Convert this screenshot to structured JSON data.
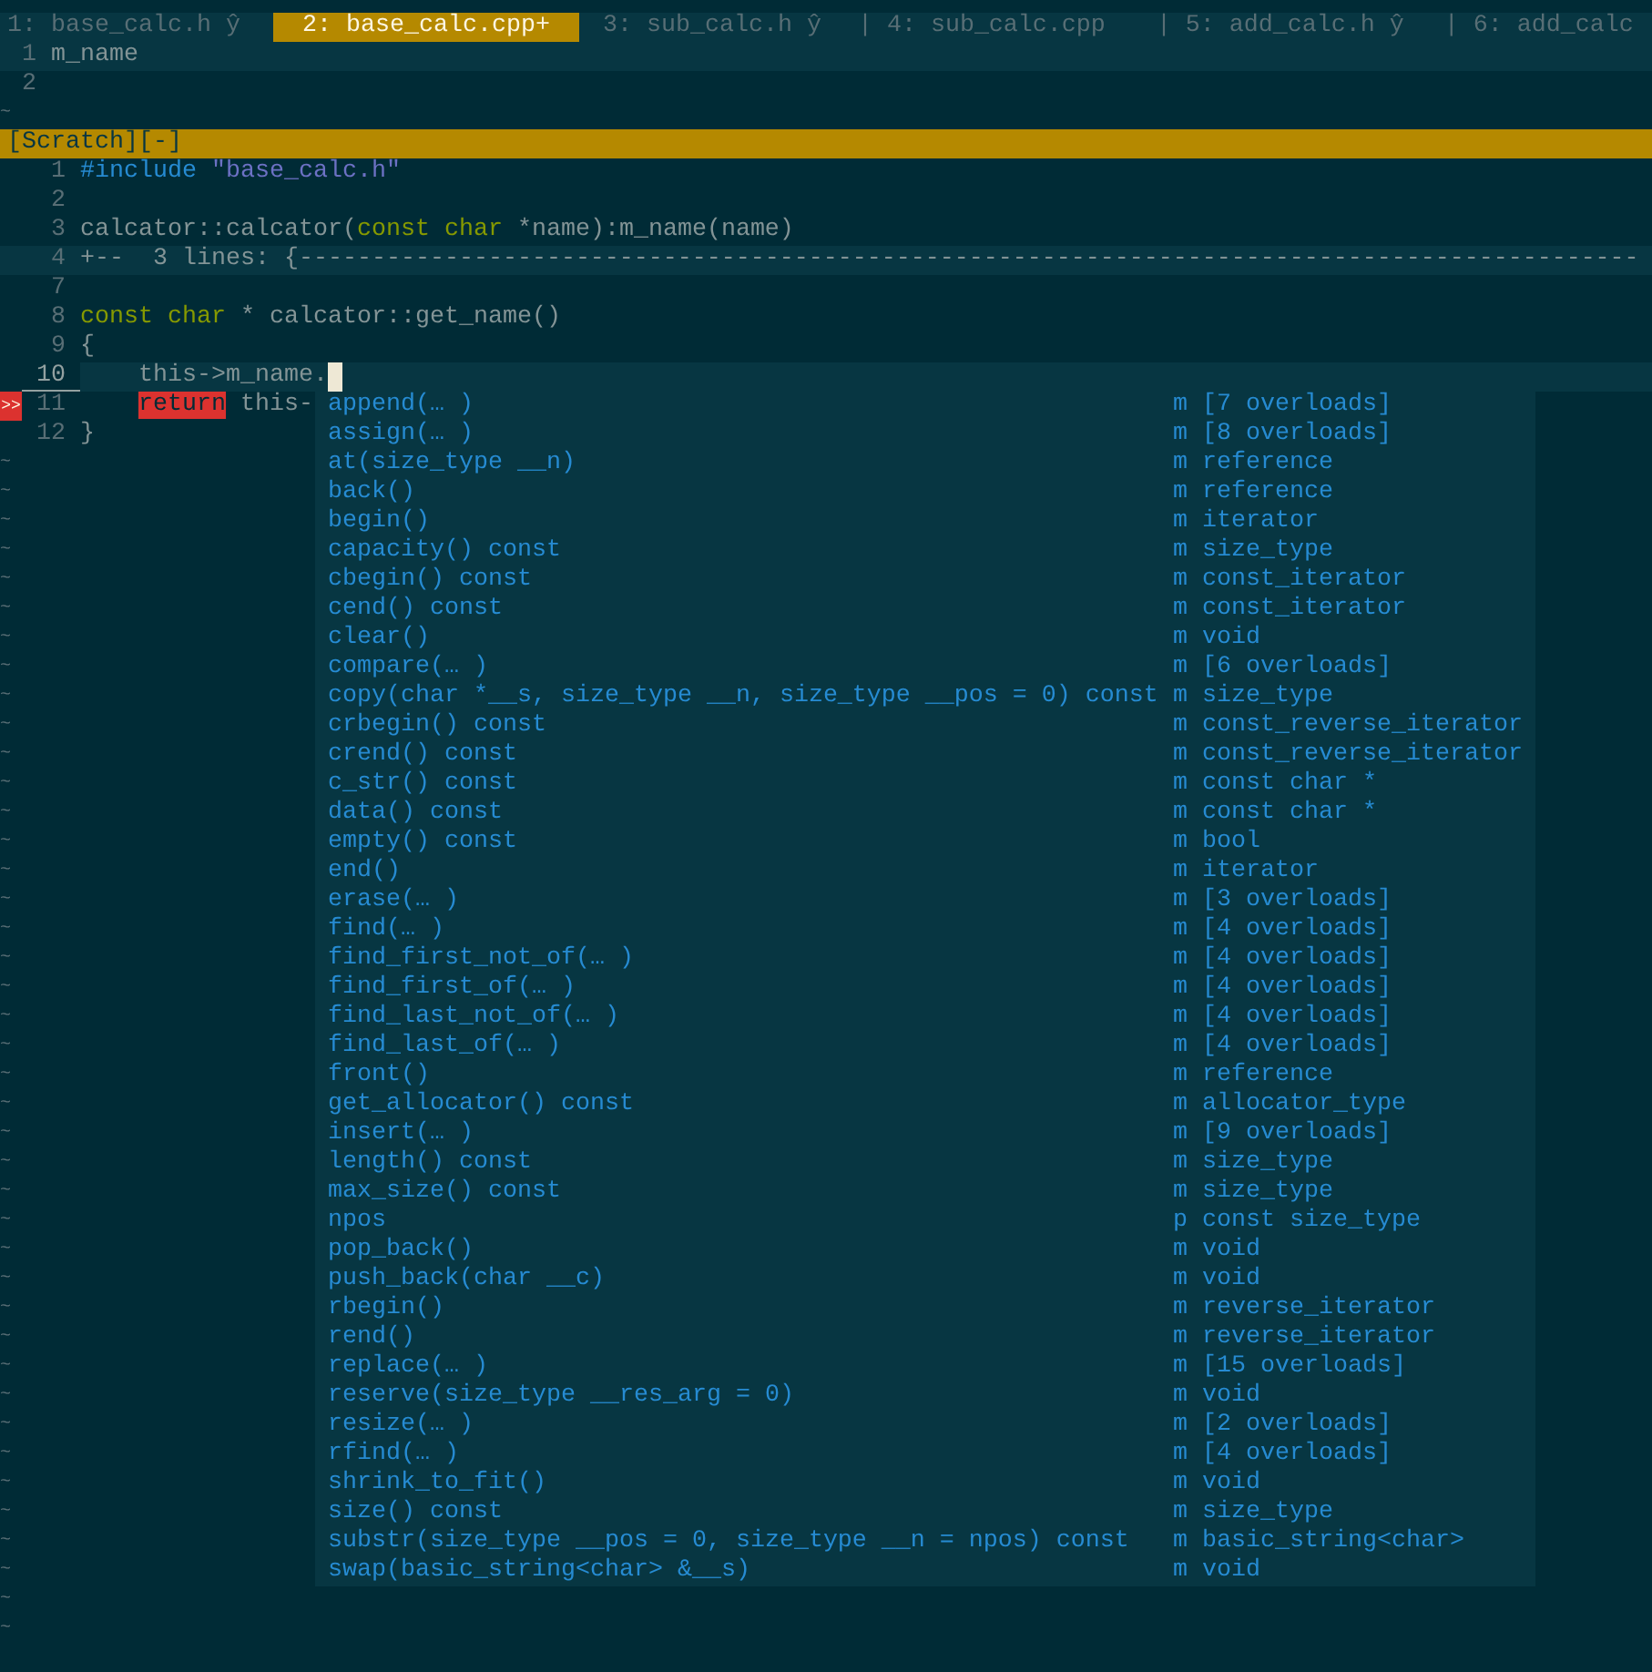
{
  "tabs": [
    {
      "label": "1: base_calc.h ŷ",
      "selected": false
    },
    {
      "label": "2: base_calc.cpp+",
      "selected": true
    },
    {
      "label": "3: sub_calc.h ŷ",
      "selected": false
    },
    {
      "label": "| 4: sub_calc.cpp",
      "selected": false
    },
    {
      "label": "| 5: add_calc.h ŷ",
      "selected": false
    },
    {
      "label": "| 6: add_calc",
      "selected": false
    }
  ],
  "top_window": {
    "lines": [
      {
        "number": "1",
        "text": "m_name",
        "current": true
      },
      {
        "number": "2",
        "current": false
      }
    ],
    "filler": [
      "~"
    ]
  },
  "status_bar": {
    "buffer": "[Scratch][-]"
  },
  "editor": {
    "lines": [
      {
        "number": "1",
        "kind": "code",
        "current": false,
        "cursor": false,
        "segments": [
          {
            "text": "#include",
            "kind": "preproc"
          },
          {
            "text": " \"base_calc.h\"",
            "kind": "string"
          }
        ]
      },
      {
        "number": "2",
        "kind": "code",
        "current": false,
        "cursor": false
      },
      {
        "number": "3",
        "kind": "code",
        "current": false,
        "cursor": false,
        "segments": [
          {
            "text": "calcator::calcator(",
            "kind": "plain"
          },
          {
            "text": "const",
            "kind": "keyword"
          },
          {
            "text": " char",
            "kind": "keyword"
          },
          {
            "text": " *name):m_name(name)",
            "kind": "plain"
          }
        ]
      },
      {
        "number": "4",
        "kind": "fold",
        "current": false,
        "cursor": false,
        "segments": [
          {
            "text": "+--  3 lines: {--------------------------------------------------------------------------------------------",
            "kind": "plain"
          }
        ]
      },
      {
        "number": "7",
        "kind": "code",
        "current": false,
        "cursor": false
      },
      {
        "number": "8",
        "kind": "code",
        "current": false,
        "cursor": false,
        "segments": [
          {
            "text": "const",
            "kind": "keyword"
          },
          {
            "text": " char",
            "kind": "keyword"
          },
          {
            "text": " * calcator::get_name()",
            "kind": "plain"
          }
        ]
      },
      {
        "number": "9",
        "kind": "code",
        "current": false,
        "cursor": false,
        "segments": [
          {
            "text": "{",
            "kind": "plain"
          }
        ]
      },
      {
        "number": "10",
        "kind": "code",
        "current": true,
        "cursor": true,
        "segments": [
          {
            "text": "    this->m_name.",
            "kind": "plain"
          }
        ]
      },
      {
        "number": "11",
        "kind": "code",
        "current": false,
        "cursor": false,
        "sign": ">>",
        "segments": [
          {
            "text": "    return",
            "kind": "error"
          },
          {
            "text": " this-",
            "kind": "plain"
          }
        ]
      },
      {
        "number": "12",
        "kind": "code",
        "current": false,
        "cursor": false,
        "segments": [
          {
            "text": "}",
            "kind": "plain"
          }
        ]
      }
    ],
    "filler": [
      "~",
      "~",
      "~",
      "~",
      "~",
      "~",
      "~",
      "~",
      "~",
      "~",
      "~",
      "~",
      "~",
      "~",
      "~",
      "~",
      "~",
      "~",
      "~",
      "~",
      "~",
      "~",
      "~",
      "~",
      "~",
      "~",
      "~",
      "~",
      "~",
      "~",
      "~",
      "~",
      "~",
      "~",
      "~",
      "~",
      "~",
      "~",
      "~",
      "~",
      "~"
    ]
  },
  "completion": [
    {
      "name": "append(… )",
      "kind": "m",
      "type": "[7 overloads]"
    },
    {
      "name": "assign(… )",
      "kind": "m",
      "type": "[8 overloads]"
    },
    {
      "name": "at(size_type __n)",
      "kind": "m",
      "type": "reference"
    },
    {
      "name": "back()",
      "kind": "m",
      "type": "reference"
    },
    {
      "name": "begin()",
      "kind": "m",
      "type": "iterator"
    },
    {
      "name": "capacity() const",
      "kind": "m",
      "type": "size_type"
    },
    {
      "name": "cbegin() const",
      "kind": "m",
      "type": "const_iterator"
    },
    {
      "name": "cend() const",
      "kind": "m",
      "type": "const_iterator"
    },
    {
      "name": "clear()",
      "kind": "m",
      "type": "void"
    },
    {
      "name": "compare(… )",
      "kind": "m",
      "type": "[6 overloads]"
    },
    {
      "name": "copy(char *__s, size_type __n, size_type __pos = 0) const",
      "kind": "m",
      "type": "size_type"
    },
    {
      "name": "crbegin() const",
      "kind": "m",
      "type": "const_reverse_iterator"
    },
    {
      "name": "crend() const",
      "kind": "m",
      "type": "const_reverse_iterator"
    },
    {
      "name": "c_str() const",
      "kind": "m",
      "type": "const char *"
    },
    {
      "name": "data() const",
      "kind": "m",
      "type": "const char *"
    },
    {
      "name": "empty() const",
      "kind": "m",
      "type": "bool"
    },
    {
      "name": "end()",
      "kind": "m",
      "type": "iterator"
    },
    {
      "name": "erase(… )",
      "kind": "m",
      "type": "[3 overloads]"
    },
    {
      "name": "find(… )",
      "kind": "m",
      "type": "[4 overloads]"
    },
    {
      "name": "find_first_not_of(… )",
      "kind": "m",
      "type": "[4 overloads]"
    },
    {
      "name": "find_first_of(… )",
      "kind": "m",
      "type": "[4 overloads]"
    },
    {
      "name": "find_last_not_of(… )",
      "kind": "m",
      "type": "[4 overloads]"
    },
    {
      "name": "find_last_of(… )",
      "kind": "m",
      "type": "[4 overloads]"
    },
    {
      "name": "front()",
      "kind": "m",
      "type": "reference"
    },
    {
      "name": "get_allocator() const",
      "kind": "m",
      "type": "allocator_type"
    },
    {
      "name": "insert(… )",
      "kind": "m",
      "type": "[9 overloads]"
    },
    {
      "name": "length() const",
      "kind": "m",
      "type": "size_type"
    },
    {
      "name": "max_size() const",
      "kind": "m",
      "type": "size_type"
    },
    {
      "name": "npos",
      "kind": "p",
      "type": "const size_type"
    },
    {
      "name": "pop_back()",
      "kind": "m",
      "type": "void"
    },
    {
      "name": "push_back(char __c)",
      "kind": "m",
      "type": "void"
    },
    {
      "name": "rbegin()",
      "kind": "m",
      "type": "reverse_iterator"
    },
    {
      "name": "rend()",
      "kind": "m",
      "type": "reverse_iterator"
    },
    {
      "name": "replace(… )",
      "kind": "m",
      "type": "[15 overloads]"
    },
    {
      "name": "reserve(size_type __res_arg = 0)",
      "kind": "m",
      "type": "void"
    },
    {
      "name": "resize(… )",
      "kind": "m",
      "type": "[2 overloads]"
    },
    {
      "name": "rfind(… )",
      "kind": "m",
      "type": "[4 overloads]"
    },
    {
      "name": "shrink_to_fit()",
      "kind": "m",
      "type": "void"
    },
    {
      "name": "size() const",
      "kind": "m",
      "type": "size_type"
    },
    {
      "name": "substr(size_type __pos = 0, size_type __n = npos) const",
      "kind": "m",
      "type": "basic_string<char>"
    },
    {
      "name": "swap(basic_string<char> &__s)",
      "kind": "m",
      "type": "void"
    }
  ]
}
